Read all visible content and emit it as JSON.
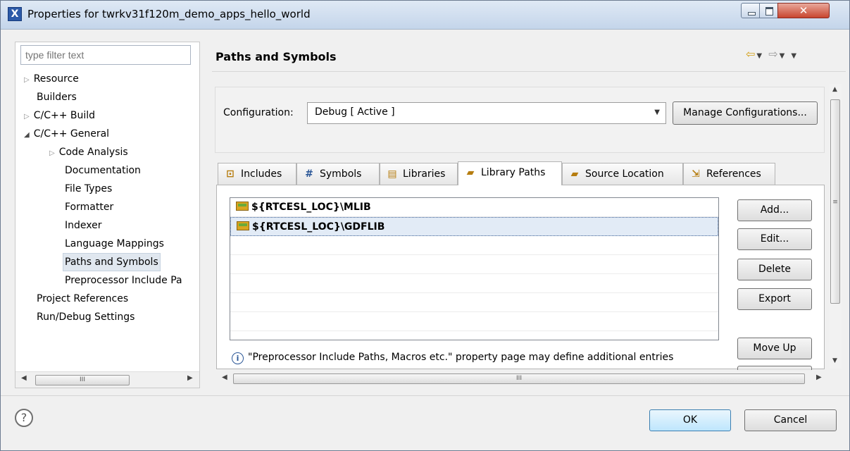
{
  "window": {
    "title": "Properties for twrkv31f120m_demo_apps_hello_world",
    "app_icon": "X"
  },
  "filter": {
    "placeholder": "type filter text"
  },
  "tree": [
    {
      "label": "Resource",
      "level": 0,
      "expander": "collapsed"
    },
    {
      "label": "Builders",
      "level": 0,
      "expander": "none"
    },
    {
      "label": "C/C++ Build",
      "level": 0,
      "expander": "collapsed"
    },
    {
      "label": "C/C++ General",
      "level": 0,
      "expander": "expanded"
    },
    {
      "label": "Code Analysis",
      "level": 1,
      "expander": "collapsed"
    },
    {
      "label": "Documentation",
      "level": 1,
      "expander": "none"
    },
    {
      "label": "File Types",
      "level": 1,
      "expander": "none"
    },
    {
      "label": "Formatter",
      "level": 1,
      "expander": "none"
    },
    {
      "label": "Indexer",
      "level": 1,
      "expander": "none"
    },
    {
      "label": "Language Mappings",
      "level": 1,
      "expander": "none"
    },
    {
      "label": "Paths and Symbols",
      "level": 1,
      "expander": "none",
      "selected": true
    },
    {
      "label": "Preprocessor Include Pa",
      "level": 1,
      "expander": "none"
    },
    {
      "label": "Project References",
      "level": 0,
      "expander": "none"
    },
    {
      "label": "Run/Debug Settings",
      "level": 0,
      "expander": "none"
    }
  ],
  "page": {
    "title": "Paths and Symbols"
  },
  "config": {
    "label": "Configuration:",
    "selected": "Debug  [ Active ]",
    "manage_label": "Manage Configurations..."
  },
  "tabs": [
    {
      "label": "Includes",
      "icon": "includes-icon",
      "active": false
    },
    {
      "label": "Symbols",
      "icon": "hash-icon",
      "active": false
    },
    {
      "label": "Libraries",
      "icon": "libraries-icon",
      "active": false
    },
    {
      "label": "Library Paths",
      "icon": "folder-icon",
      "active": true
    },
    {
      "label": "Source Location",
      "icon": "source-folder-icon",
      "active": false
    },
    {
      "label": "References",
      "icon": "references-icon",
      "active": false
    }
  ],
  "library_paths": [
    {
      "path": "${RTCESL_LOC}\\MLIB",
      "selected": false
    },
    {
      "path": "${RTCESL_LOC}\\GDFLIB",
      "selected": true
    }
  ],
  "info_text": "\"Preprocessor Include Paths, Macros etc.\" property page may define additional entries",
  "buttons": {
    "add": "Add...",
    "edit": "Edit...",
    "delete": "Delete",
    "export": "Export",
    "move_up": "Move Up",
    "ok": "OK",
    "cancel": "Cancel"
  },
  "scroll_glyph": "III",
  "colors": {
    "accent": "#3c7fb1",
    "selection": "#e2ebf6",
    "nav_arrow": "#d4a017"
  }
}
